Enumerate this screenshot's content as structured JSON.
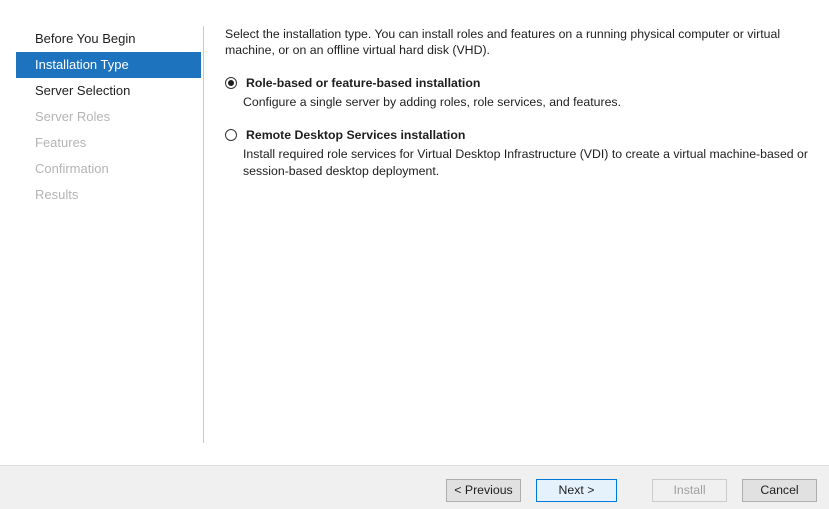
{
  "nav": {
    "items": [
      {
        "label": "Before You Begin",
        "state": "normal"
      },
      {
        "label": "Installation Type",
        "state": "active"
      },
      {
        "label": "Server Selection",
        "state": "normal"
      },
      {
        "label": "Server Roles",
        "state": "disabled"
      },
      {
        "label": "Features",
        "state": "disabled"
      },
      {
        "label": "Confirmation",
        "state": "disabled"
      },
      {
        "label": "Results",
        "state": "disabled"
      }
    ]
  },
  "main": {
    "intro": "Select the installation type. You can install roles and features on a running physical computer or virtual machine, or on an offline virtual hard disk (VHD).",
    "options": [
      {
        "title": "Role-based or feature-based installation",
        "description": "Configure a single server by adding roles, role services, and features.",
        "selected": true
      },
      {
        "title": "Remote Desktop Services installation",
        "description": "Install required role services for Virtual Desktop Infrastructure (VDI) to create a virtual machine-based or session-based desktop deployment.",
        "selected": false
      }
    ]
  },
  "footer": {
    "previous_label": "< Previous",
    "next_label": "Next >",
    "install_label": "Install",
    "cancel_label": "Cancel"
  },
  "colors": {
    "accent": "#1e73be",
    "disabled_text": "#b4b4b4",
    "footer_bg": "#f0f0f0"
  }
}
